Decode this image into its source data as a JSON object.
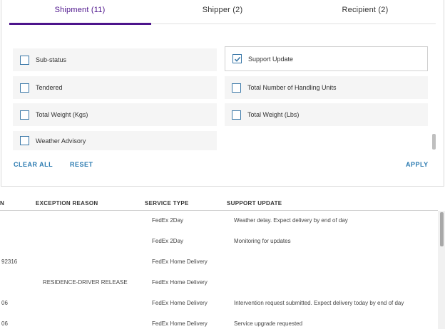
{
  "tabs": [
    {
      "label": "Shipment (11)"
    },
    {
      "label": "Shipper (2)"
    },
    {
      "label": "Recipient (2)"
    }
  ],
  "options": [
    {
      "label": "Sub-status",
      "checked": false
    },
    {
      "label": "Support Update",
      "checked": true
    },
    {
      "label": "Tendered",
      "checked": false
    },
    {
      "label": "Total Number of Handling Units",
      "checked": false
    },
    {
      "label": "Total Weight (Kgs)",
      "checked": false
    },
    {
      "label": "Total Weight (Lbs)",
      "checked": false
    },
    {
      "label": "Weather Advisory",
      "checked": false
    }
  ],
  "actions": {
    "clear_all": "CLEAR ALL",
    "reset": "RESET",
    "apply": "APPLY"
  },
  "table": {
    "headers": [
      "N",
      "EXCEPTION REASON",
      "SERVICE TYPE",
      "SUPPORT UPDATE"
    ],
    "rows": [
      {
        "c0": "",
        "exception": "",
        "service": "FedEx 2Day",
        "update": "Weather delay. Expect delivery by end of day"
      },
      {
        "c0": "",
        "exception": "",
        "service": "FedEx 2Day",
        "update": "Monitoring for updates"
      },
      {
        "c0": "92316",
        "exception": "",
        "service": "FedEx Home Delivery",
        "update": ""
      },
      {
        "c0": "",
        "exception": "RESIDENCE-DRIVER RELEASE",
        "service": "FedEx Home Delivery",
        "update": ""
      },
      {
        "c0": "06",
        "exception": "",
        "service": "FedEx Home Delivery",
        "update": "Intervention request submitted. Expect delivery today by end of day"
      },
      {
        "c0": "06",
        "exception": "",
        "service": "FedEx Home Delivery",
        "update": "Service upgrade requested"
      }
    ]
  },
  "colors": {
    "accent": "#4d148c",
    "link": "#2a7ab0",
    "checkbox": "#3a78a8"
  }
}
